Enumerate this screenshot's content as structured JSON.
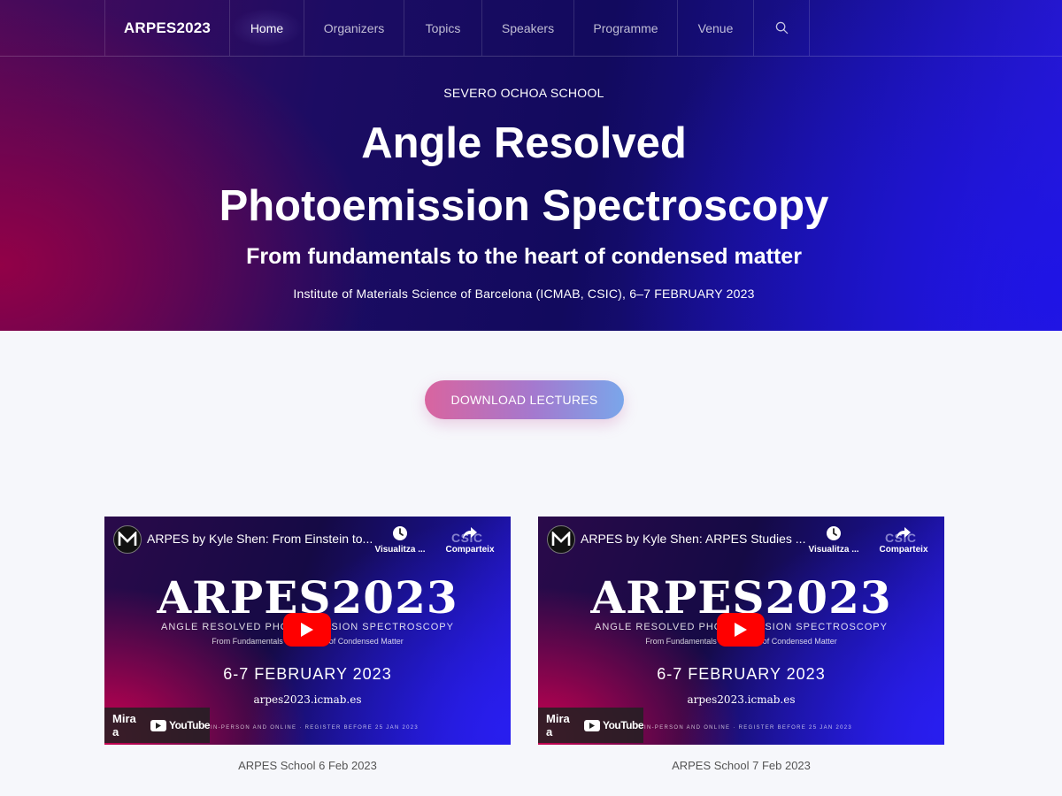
{
  "nav": {
    "brand": "ARPES2023",
    "items": [
      "Home",
      "Organizers",
      "Topics",
      "Speakers",
      "Programme",
      "Venue"
    ],
    "search_icon": "search-icon"
  },
  "hero": {
    "eyebrow": "SEVERO OCHOA SCHOOL",
    "title_line1": "Angle Resolved",
    "title_line2": "Photoemission Spectroscopy",
    "subtitle": "From fundamentals to the heart of condensed matter",
    "place": "Institute of Materials Science of Barcelona (ICMAB, CSIC), 6–7 FEBRUARY 2023"
  },
  "download_button": "DOWNLOAD LECTURES",
  "videos": [
    {
      "title": "ARPES by Kyle Shen: From Einstein to...",
      "watch_later": "Visualitza ...",
      "share": "Comparteix",
      "csic": "CSIC",
      "thumb_title": "ARPES2023",
      "thumb_subtitle": "ANGLE RESOLVED PHOTOEMISSION SPECTROSCOPY",
      "thumb_subtitle2": "From Fundamentals to the Heart of Condensed Matter",
      "thumb_date": "6-7 FEBRUARY 2023",
      "thumb_url": "arpes2023.icmab.es",
      "thumb_register": "IN-PERSON AND ONLINE · REGISTER BEFORE 25 JAN 2023",
      "watch_on": "Mira a",
      "youtube": "YouTube",
      "caption": "ARPES School 6 Feb 2023"
    },
    {
      "title": "ARPES by Kyle Shen: ARPES Studies ...",
      "watch_later": "Visualitza ...",
      "share": "Comparteix",
      "csic": "CSIC",
      "thumb_title": "ARPES2023",
      "thumb_subtitle": "ANGLE RESOLVED PHOTOEMISSION SPECTROSCOPY",
      "thumb_subtitle2": "From Fundamentals to the Heart of Condensed Matter",
      "thumb_date": "6-7 FEBRUARY 2023",
      "thumb_url": "arpes2023.icmab.es",
      "thumb_register": "IN-PERSON AND ONLINE · REGISTER BEFORE 25 JAN 2023",
      "watch_on": "Mira a",
      "youtube": "YouTube",
      "caption": "ARPES School 7 Feb 2023"
    }
  ]
}
